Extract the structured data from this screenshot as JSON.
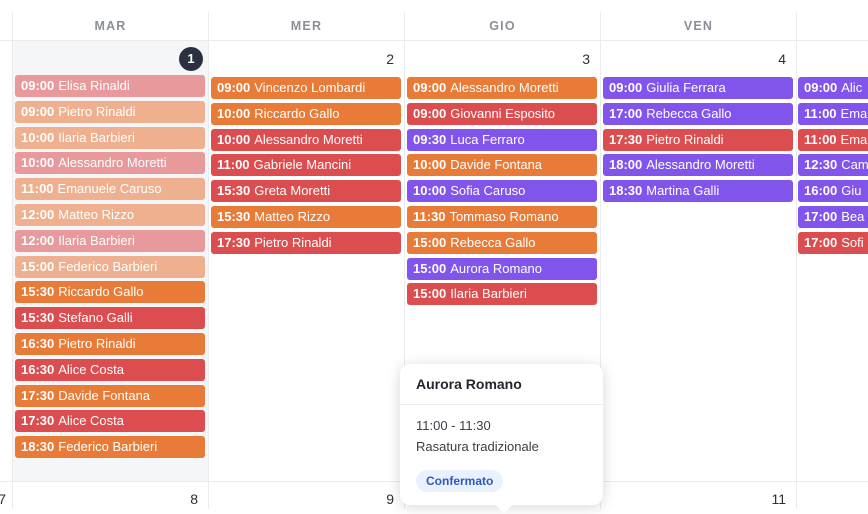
{
  "headers": {
    "mar": "MAR",
    "mer": "MER",
    "gio": "GIO",
    "ven": "VEN"
  },
  "days": {
    "mar": "1",
    "mer": "2",
    "gio": "3",
    "ven": "4",
    "left_next": "7",
    "mar_next": "8",
    "mer_next": "9",
    "ven_next": "11"
  },
  "colors": {
    "pink": "#e8999b",
    "peach": "#efb08f",
    "orange": "#e87b37",
    "red": "#dc4d4f",
    "purple": "#8154ec"
  },
  "popover": {
    "name": "Aurora Romano",
    "time": "11:00 - 11:30",
    "service": "Rasatura tradizionale",
    "status": "Confermato"
  },
  "events": {
    "mar": [
      {
        "time": "09:00",
        "name": "Elisa Rinaldi",
        "color": "pink"
      },
      {
        "time": "09:00",
        "name": "Pietro Rinaldi",
        "color": "peach"
      },
      {
        "time": "10:00",
        "name": "Ilaria Barbieri",
        "color": "peach"
      },
      {
        "time": "10:00",
        "name": "Alessandro Moretti",
        "color": "pink"
      },
      {
        "time": "11:00",
        "name": "Emanuele Caruso",
        "color": "peach"
      },
      {
        "time": "12:00",
        "name": "Matteo Rizzo",
        "color": "peach"
      },
      {
        "time": "12:00",
        "name": "Ilaria Barbieri",
        "color": "pink"
      },
      {
        "time": "15:00",
        "name": "Federico Barbieri",
        "color": "peach"
      },
      {
        "time": "15:30",
        "name": "Riccardo Gallo",
        "color": "orange"
      },
      {
        "time": "15:30",
        "name": "Stefano Galli",
        "color": "red"
      },
      {
        "time": "16:30",
        "name": "Pietro Rinaldi",
        "color": "orange"
      },
      {
        "time": "16:30",
        "name": "Alice Costa",
        "color": "red"
      },
      {
        "time": "17:30",
        "name": "Davide Fontana",
        "color": "orange"
      },
      {
        "time": "17:30",
        "name": "Alice Costa",
        "color": "red"
      },
      {
        "time": "18:30",
        "name": "Federico Barbieri",
        "color": "orange"
      }
    ],
    "mer": [
      {
        "time": "09:00",
        "name": "Vincenzo Lombardi",
        "color": "orange"
      },
      {
        "time": "10:00",
        "name": "Riccardo Gallo",
        "color": "orange"
      },
      {
        "time": "10:00",
        "name": "Alessandro Moretti",
        "color": "red"
      },
      {
        "time": "11:00",
        "name": "Gabriele Mancini",
        "color": "red"
      },
      {
        "time": "15:30",
        "name": "Greta Moretti",
        "color": "red"
      },
      {
        "time": "15:30",
        "name": "Matteo Rizzo",
        "color": "orange"
      },
      {
        "time": "17:30",
        "name": "Pietro Rinaldi",
        "color": "red"
      }
    ],
    "gio": [
      {
        "time": "09:00",
        "name": "Alessandro Moretti",
        "color": "orange"
      },
      {
        "time": "09:00",
        "name": "Giovanni Esposito",
        "color": "red"
      },
      {
        "time": "09:30",
        "name": "Luca Ferraro",
        "color": "purple"
      },
      {
        "time": "10:00",
        "name": "Davide Fontana",
        "color": "orange"
      },
      {
        "time": "10:00",
        "name": "Sofia Caruso",
        "color": "purple"
      },
      {
        "time": "11:30",
        "name": "Tommaso Romano",
        "color": "orange"
      },
      {
        "time": "15:00",
        "name": "Rebecca Gallo",
        "color": "orange"
      },
      {
        "time": "15:00",
        "name": "Aurora Romano",
        "color": "purple"
      },
      {
        "time": "15:00",
        "name": "Ilaria Barbieri",
        "color": "red"
      }
    ],
    "ven": [
      {
        "time": "09:00",
        "name": "Giulia Ferrara",
        "color": "purple"
      },
      {
        "time": "17:00",
        "name": "Rebecca Gallo",
        "color": "purple"
      },
      {
        "time": "17:30",
        "name": "Pietro Rinaldi",
        "color": "red"
      },
      {
        "time": "18:00",
        "name": "Alessandro Moretti",
        "color": "purple"
      },
      {
        "time": "18:30",
        "name": "Martina Galli",
        "color": "purple"
      }
    ],
    "sab": [
      {
        "time": "09:00",
        "name": "Alic",
        "color": "purple"
      },
      {
        "time": "11:00",
        "name": "Ema",
        "color": "purple"
      },
      {
        "time": "11:00",
        "name": "Ema",
        "color": "red"
      },
      {
        "time": "12:30",
        "name": "Cam",
        "color": "purple"
      },
      {
        "time": "16:00",
        "name": "Giu",
        "color": "purple"
      },
      {
        "time": "17:00",
        "name": "Bea",
        "color": "purple"
      },
      {
        "time": "17:00",
        "name": "Sofi",
        "color": "red"
      }
    ]
  }
}
